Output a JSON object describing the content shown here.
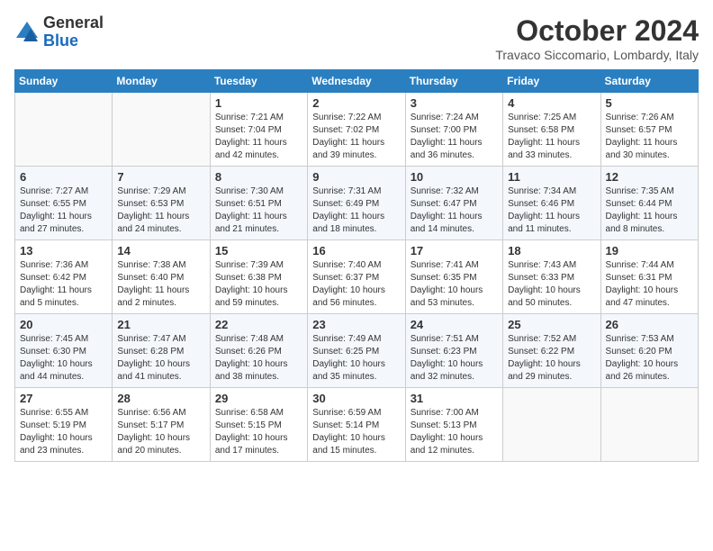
{
  "header": {
    "logo_line1": "General",
    "logo_line2": "Blue",
    "month": "October 2024",
    "location": "Travaco Siccomario, Lombardy, Italy"
  },
  "weekdays": [
    "Sunday",
    "Monday",
    "Tuesday",
    "Wednesday",
    "Thursday",
    "Friday",
    "Saturday"
  ],
  "weeks": [
    [
      {
        "day": "",
        "info": ""
      },
      {
        "day": "",
        "info": ""
      },
      {
        "day": "1",
        "info": "Sunrise: 7:21 AM\nSunset: 7:04 PM\nDaylight: 11 hours and 42 minutes."
      },
      {
        "day": "2",
        "info": "Sunrise: 7:22 AM\nSunset: 7:02 PM\nDaylight: 11 hours and 39 minutes."
      },
      {
        "day": "3",
        "info": "Sunrise: 7:24 AM\nSunset: 7:00 PM\nDaylight: 11 hours and 36 minutes."
      },
      {
        "day": "4",
        "info": "Sunrise: 7:25 AM\nSunset: 6:58 PM\nDaylight: 11 hours and 33 minutes."
      },
      {
        "day": "5",
        "info": "Sunrise: 7:26 AM\nSunset: 6:57 PM\nDaylight: 11 hours and 30 minutes."
      }
    ],
    [
      {
        "day": "6",
        "info": "Sunrise: 7:27 AM\nSunset: 6:55 PM\nDaylight: 11 hours and 27 minutes."
      },
      {
        "day": "7",
        "info": "Sunrise: 7:29 AM\nSunset: 6:53 PM\nDaylight: 11 hours and 24 minutes."
      },
      {
        "day": "8",
        "info": "Sunrise: 7:30 AM\nSunset: 6:51 PM\nDaylight: 11 hours and 21 minutes."
      },
      {
        "day": "9",
        "info": "Sunrise: 7:31 AM\nSunset: 6:49 PM\nDaylight: 11 hours and 18 minutes."
      },
      {
        "day": "10",
        "info": "Sunrise: 7:32 AM\nSunset: 6:47 PM\nDaylight: 11 hours and 14 minutes."
      },
      {
        "day": "11",
        "info": "Sunrise: 7:34 AM\nSunset: 6:46 PM\nDaylight: 11 hours and 11 minutes."
      },
      {
        "day": "12",
        "info": "Sunrise: 7:35 AM\nSunset: 6:44 PM\nDaylight: 11 hours and 8 minutes."
      }
    ],
    [
      {
        "day": "13",
        "info": "Sunrise: 7:36 AM\nSunset: 6:42 PM\nDaylight: 11 hours and 5 minutes."
      },
      {
        "day": "14",
        "info": "Sunrise: 7:38 AM\nSunset: 6:40 PM\nDaylight: 11 hours and 2 minutes."
      },
      {
        "day": "15",
        "info": "Sunrise: 7:39 AM\nSunset: 6:38 PM\nDaylight: 10 hours and 59 minutes."
      },
      {
        "day": "16",
        "info": "Sunrise: 7:40 AM\nSunset: 6:37 PM\nDaylight: 10 hours and 56 minutes."
      },
      {
        "day": "17",
        "info": "Sunrise: 7:41 AM\nSunset: 6:35 PM\nDaylight: 10 hours and 53 minutes."
      },
      {
        "day": "18",
        "info": "Sunrise: 7:43 AM\nSunset: 6:33 PM\nDaylight: 10 hours and 50 minutes."
      },
      {
        "day": "19",
        "info": "Sunrise: 7:44 AM\nSunset: 6:31 PM\nDaylight: 10 hours and 47 minutes."
      }
    ],
    [
      {
        "day": "20",
        "info": "Sunrise: 7:45 AM\nSunset: 6:30 PM\nDaylight: 10 hours and 44 minutes."
      },
      {
        "day": "21",
        "info": "Sunrise: 7:47 AM\nSunset: 6:28 PM\nDaylight: 10 hours and 41 minutes."
      },
      {
        "day": "22",
        "info": "Sunrise: 7:48 AM\nSunset: 6:26 PM\nDaylight: 10 hours and 38 minutes."
      },
      {
        "day": "23",
        "info": "Sunrise: 7:49 AM\nSunset: 6:25 PM\nDaylight: 10 hours and 35 minutes."
      },
      {
        "day": "24",
        "info": "Sunrise: 7:51 AM\nSunset: 6:23 PM\nDaylight: 10 hours and 32 minutes."
      },
      {
        "day": "25",
        "info": "Sunrise: 7:52 AM\nSunset: 6:22 PM\nDaylight: 10 hours and 29 minutes."
      },
      {
        "day": "26",
        "info": "Sunrise: 7:53 AM\nSunset: 6:20 PM\nDaylight: 10 hours and 26 minutes."
      }
    ],
    [
      {
        "day": "27",
        "info": "Sunrise: 6:55 AM\nSunset: 5:19 PM\nDaylight: 10 hours and 23 minutes."
      },
      {
        "day": "28",
        "info": "Sunrise: 6:56 AM\nSunset: 5:17 PM\nDaylight: 10 hours and 20 minutes."
      },
      {
        "day": "29",
        "info": "Sunrise: 6:58 AM\nSunset: 5:15 PM\nDaylight: 10 hours and 17 minutes."
      },
      {
        "day": "30",
        "info": "Sunrise: 6:59 AM\nSunset: 5:14 PM\nDaylight: 10 hours and 15 minutes."
      },
      {
        "day": "31",
        "info": "Sunrise: 7:00 AM\nSunset: 5:13 PM\nDaylight: 10 hours and 12 minutes."
      },
      {
        "day": "",
        "info": ""
      },
      {
        "day": "",
        "info": ""
      }
    ]
  ]
}
